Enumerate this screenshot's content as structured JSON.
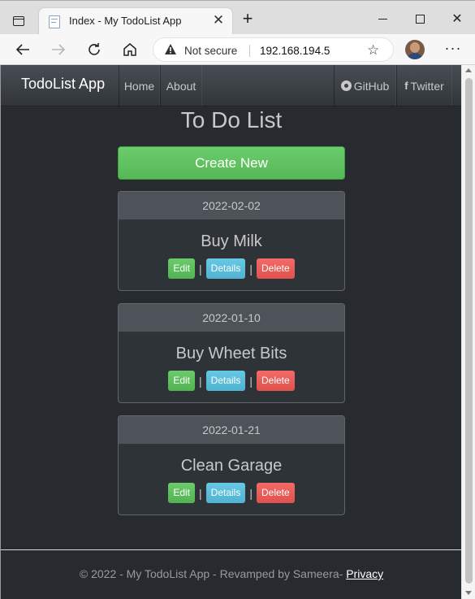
{
  "browser": {
    "tab_title": "Index - My TodoList App",
    "new_tab": "+",
    "close_tab": "✕",
    "security_label": "Not secure",
    "url": "192.168.194.5",
    "more": "···"
  },
  "navbar": {
    "brand": "TodoList App",
    "links": [
      "Home",
      "About"
    ],
    "social": [
      {
        "icon": "github-icon",
        "label": "GitHub"
      },
      {
        "icon": "facebook-icon",
        "label": "Twitter"
      }
    ]
  },
  "page": {
    "heading": "To Do List",
    "create_button": "Create New"
  },
  "todos": [
    {
      "date": "2022-02-02",
      "title": "Buy Milk"
    },
    {
      "date": "2022-01-10",
      "title": "Buy Wheet Bits"
    },
    {
      "date": "2022-01-21",
      "title": "Clean Garage"
    }
  ],
  "actions": {
    "edit": "Edit",
    "details": "Details",
    "delete": "Delete",
    "separator": "|"
  },
  "footer": {
    "text": "© 2022 - My TodoList App - Revamped by Sameera- ",
    "privacy": "Privacy"
  },
  "colors": {
    "page_bg": "#272b30",
    "navbar_bg": "#3a3f44",
    "success": "#62c462",
    "info": "#5bc0de",
    "danger": "#ee5f5b"
  }
}
